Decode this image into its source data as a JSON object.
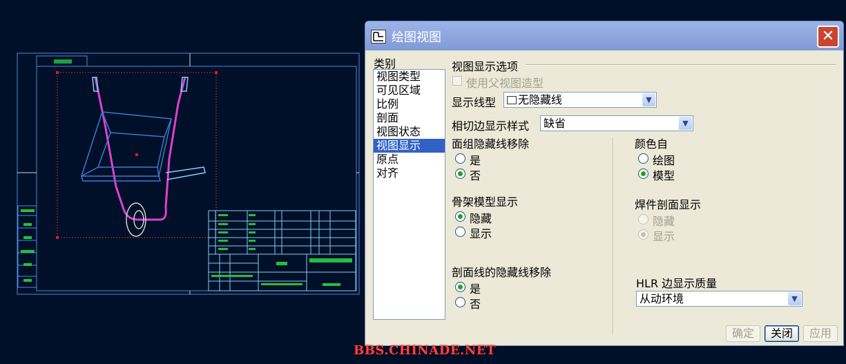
{
  "dialog": {
    "title": "绘图视图",
    "close_glyph": "✕",
    "category_label": "类别",
    "categories": [
      "视图类型",
      "可见区域",
      "比例",
      "剖面",
      "视图状态",
      "视图显示",
      "原点",
      "对齐"
    ],
    "selected_category": "视图显示",
    "group_title": "视图显示选项",
    "use_parent_label": "使用父视图造型",
    "display_style_label": "显示线型",
    "display_style_value": "无隐藏线",
    "tangent_label": "相切边显示样式",
    "tangent_value": "缺省",
    "quilt_hlr_label": "面组隐藏线移除",
    "quilt_options": [
      "是",
      "否"
    ],
    "quilt_selected": "否",
    "color_from_label": "颜色自",
    "color_options": [
      "绘图",
      "模型"
    ],
    "color_selected": "模型",
    "skeleton_label": "骨架模型显示",
    "skeleton_options": [
      "隐藏",
      "显示"
    ],
    "skeleton_selected": "隐藏",
    "weld_label": "焊件剖面显示",
    "weld_options": [
      "隐藏",
      "显示"
    ],
    "weld_selected": "显示",
    "xsec_hlr_label": "剖面线的隐藏线移除",
    "xsec_options": [
      "是",
      "否"
    ],
    "xsec_selected": "是",
    "hlr_quality_label": "HLR 边显示质量",
    "hlr_quality_value": "从动环境",
    "buttons": {
      "ok": "确定",
      "close": "关闭",
      "apply": "应用"
    }
  },
  "watermark": "BBS.CHINADE.NET",
  "colors": {
    "cad_background": "#001028",
    "cad_lines": "#3a7bd5",
    "cad_frame": "#4a8ae0",
    "title_block": "#7fd0ff",
    "frame_pipe": "#e040d0",
    "selection_box": "#d82020",
    "accent": "#3161c5",
    "close_button": "#c9452f",
    "watermark": "#ff4040"
  },
  "icons": [
    "dialog-icon",
    "close-icon",
    "chevron-down-icon",
    "display-style-icon"
  ]
}
